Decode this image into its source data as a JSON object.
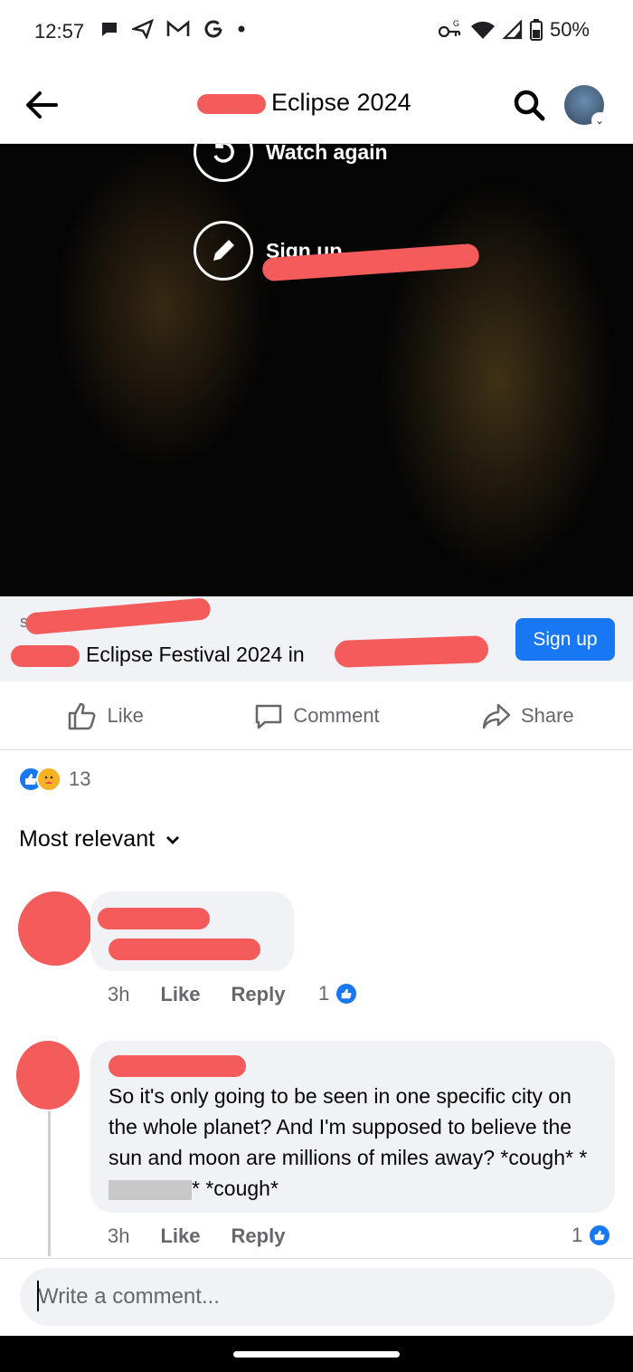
{
  "status_bar": {
    "time": "12:57",
    "battery": "50%",
    "left_icons": [
      "chat-icon",
      "send-icon",
      "gmail-icon",
      "google-icon",
      "dot-icon"
    ],
    "right_icons": [
      "key-icon",
      "wifi-icon",
      "signal-icon",
      "battery-icon"
    ]
  },
  "header": {
    "title": "Eclipse 2024"
  },
  "video": {
    "watch_again_label": "Watch again",
    "sign_up_label": "Sign up"
  },
  "link_card": {
    "domain": "s                         om",
    "title": "Eclipse Festival 2024 in",
    "cta_label": "Sign up"
  },
  "actions": {
    "like_label": "Like",
    "comment_label": "Comment",
    "share_label": "Share"
  },
  "reactions": {
    "count": "13"
  },
  "sort": {
    "label": "Most relevant"
  },
  "comments": [
    {
      "time": "3h",
      "like_label": "Like",
      "reply_label": "Reply",
      "like_count": "1"
    },
    {
      "text_before": "So it's only going to be seen in one specific city on the whole planet? And I'm supposed to believe the sun and moon are millions of miles away? *cough* *",
      "text_after": "* *cough*",
      "time": "3h",
      "like_label": "Like",
      "reply_label": "Reply",
      "like_count": "1"
    }
  ],
  "composer": {
    "placeholder": "Write a comment..."
  },
  "colors": {
    "brand_blue": "#1877f2",
    "redaction": "#f45b5b",
    "highlight": "#f7e27e"
  }
}
